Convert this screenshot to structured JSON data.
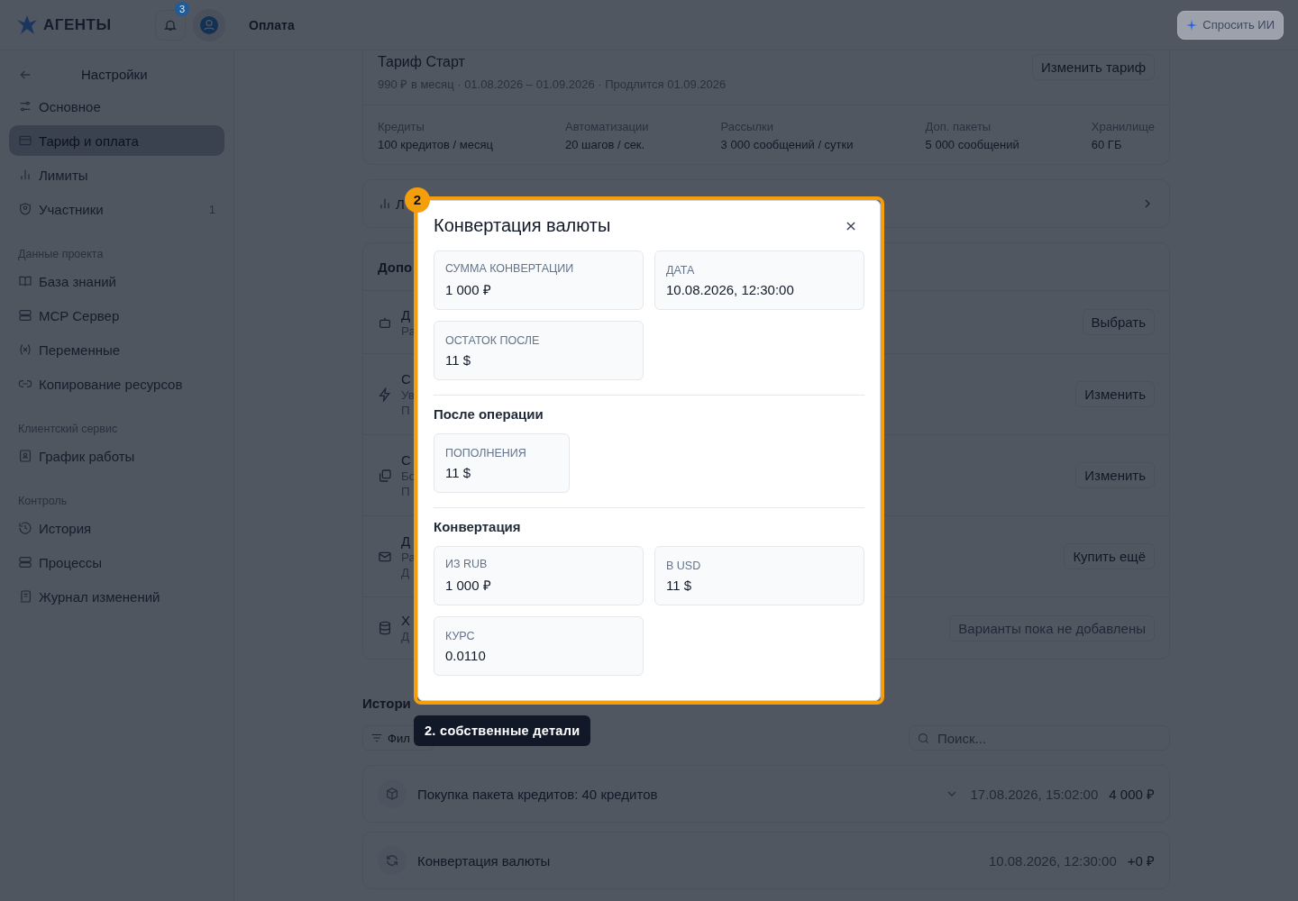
{
  "header": {
    "logo": "АГЕНТЫ",
    "notification_count": "3",
    "breadcrumb": "Оплата",
    "ask_ai": "Спросить ИИ"
  },
  "sidebar": {
    "title": "Настройки",
    "sections": [
      {
        "items": [
          {
            "label": "Основное",
            "selected": false
          },
          {
            "label": "Тариф и оплата",
            "selected": true
          },
          {
            "label": "Лимиты",
            "selected": false
          },
          {
            "label": "Участники",
            "selected": false,
            "count": "1"
          }
        ]
      },
      {
        "heading": "Данные проекта",
        "items": [
          {
            "label": "База знаний",
            "selected": false
          },
          {
            "label": "MCP Сервер",
            "selected": false
          },
          {
            "label": "Переменные",
            "selected": false
          },
          {
            "label": "Копирование ресурсов",
            "selected": false
          }
        ]
      },
      {
        "heading": "Клиентский сервис",
        "items": [
          {
            "label": "График работы",
            "selected": false
          }
        ]
      },
      {
        "heading": "Контроль",
        "items": [
          {
            "label": "История",
            "selected": false
          },
          {
            "label": "Процессы",
            "selected": false
          },
          {
            "label": "Журнал изменений",
            "selected": false
          }
        ]
      }
    ]
  },
  "plan": {
    "title": "Тариф Старт",
    "meta": "990 ₽ в месяц · 01.08.2026 – 01.09.2026 · Продлится 01.09.2026",
    "button": "Изменить тариф",
    "stats": [
      {
        "label": "Кредиты",
        "value": "100 кредитов / месяц"
      },
      {
        "label": "Автоматизации",
        "value": "20 шагов / сек."
      },
      {
        "label": "Рассылки",
        "value": "3 000 сообщений / сутки"
      },
      {
        "label": "Доп. пакеты",
        "value": "5 000 сообщений"
      },
      {
        "label": "Хранилище",
        "value": "60 ГБ"
      }
    ]
  },
  "limits_row": {
    "label": "Л"
  },
  "addons": {
    "heading": "Допо",
    "rows": [
      {
        "title": "Д",
        "lines": [
          "Ра"
        ],
        "action": "Выбрать",
        "kind": "button"
      },
      {
        "title": "С",
        "lines": [
          "Ув",
          "П"
        ],
        "action": "Изменить",
        "kind": "button"
      },
      {
        "title": "С",
        "lines": [
          "Бо",
          "П"
        ],
        "action": "Изменить",
        "kind": "button"
      },
      {
        "title": "Д",
        "lines": [
          "Ра",
          "Д"
        ],
        "action": "Купить ещё",
        "kind": "button"
      },
      {
        "title": "Х",
        "lines": [
          "Д"
        ],
        "action": "Варианты пока не добавлены",
        "kind": "note"
      }
    ]
  },
  "history": {
    "heading": "Истори",
    "filter": "Фил",
    "search": {
      "placeholder": "Поиск..."
    },
    "rows": [
      {
        "title": "Покупка пакета кредитов: 40 кредитов",
        "expandable": true,
        "date": "17.08.2026, 15:02:00",
        "amount": "4 000 ₽"
      },
      {
        "title": "Конвертация валюты",
        "expandable": false,
        "date": "10.08.2026, 12:30:00",
        "amount": "+0 ₽"
      }
    ]
  },
  "modal": {
    "title": "Конвертация валюты",
    "sections": [
      {
        "fields": [
          {
            "label": "СУММА КОНВЕРТАЦИИ",
            "value": "1 000 ₽"
          },
          {
            "label": "ДАТА",
            "value": "10.08.2026, 12:30:00"
          },
          {
            "label": "ОСТАТОК ПОСЛЕ",
            "value": "11 $"
          }
        ]
      },
      {
        "heading": "После операции",
        "fields": [
          {
            "label": "ПОПОЛНЕНИЯ",
            "value": "11 $"
          }
        ]
      },
      {
        "heading": "Конвертация",
        "fields": [
          {
            "label": "ИЗ RUB",
            "value": "1 000 ₽"
          },
          {
            "label": "В USD",
            "value": "11 $"
          },
          {
            "label": "КУРС",
            "value": "0.0110"
          }
        ]
      }
    ]
  },
  "highlight": {
    "number": "2",
    "caption": "2. собственные детали"
  }
}
